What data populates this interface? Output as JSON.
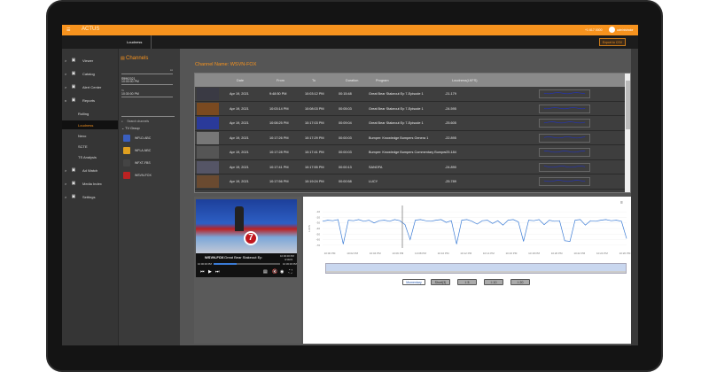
{
  "header": {
    "logo": "ACTUS",
    "phone": "+1 617 0000",
    "user": "administrator",
    "accent": "#f7931e"
  },
  "tabs": [
    {
      "label": "Loudness",
      "active": true
    }
  ],
  "export_label": "Export to CSV",
  "sidebar": {
    "items": [
      {
        "label": "Viewer",
        "icon": "monitor-icon",
        "chevron": ">"
      },
      {
        "label": "Catalog",
        "icon": "list-icon",
        "chevron": ">"
      },
      {
        "label": "Alert Center",
        "icon": "bell-icon",
        "chevron": ">"
      },
      {
        "label": "Reports",
        "icon": "trend-icon",
        "chevron": "v"
      },
      {
        "label": "Rolling",
        "sub": true
      },
      {
        "label": "Loudness",
        "sub": true,
        "active": true
      },
      {
        "label": "Nexo",
        "sub": true
      },
      {
        "label": "SCTE",
        "sub": true
      },
      {
        "label": "TS Analysis",
        "sub": true
      },
      {
        "label": "Ad Watch",
        "icon": "ad-icon",
        "chevron": ">"
      },
      {
        "label": "Media Index",
        "icon": "media-icon",
        "chevron": ">"
      },
      {
        "label": "Settings",
        "icon": "gear-icon",
        "chevron": ">"
      }
    ]
  },
  "channels": {
    "title": "Channels",
    "date": "4/19/2021",
    "from_label": "From",
    "from": "10:00:00 PM",
    "to_label": "To",
    "to": "10:30:00 PM",
    "search_placeholder": "Search channels",
    "group": "TV Group",
    "list": [
      "WFLD-ABC",
      "WFLA-NBC",
      "WFXT-FBS",
      "WSVN-FOX"
    ]
  },
  "main": {
    "channel_name": "Channel Name: WSVN-FOX",
    "columns": [
      "Date",
      "From",
      "To",
      "Duration",
      "Program",
      "Loudness(LKFS)"
    ],
    "rows": [
      [
        "Apr 19, 2021",
        "9:48:50 PM",
        "10:03:12 PM",
        "00:15:48",
        "Great Bear Stakeout Ep 7-Episode 1",
        "-21.179"
      ],
      [
        "Apr 19, 2021",
        "10:03:14 PM",
        "10:08:03 PM",
        "00:05:03",
        "Great Bear Stakeout Ep 7-Episode 1",
        "-24.595"
      ],
      [
        "Apr 19, 2021",
        "10:08:25 PM",
        "10:17:03 PM",
        "00:09:04",
        "Great Bear Stakeout Ep 7-Episode 1",
        "-25.605"
      ],
      [
        "Apr 19, 2021",
        "10:17:26 PM",
        "10:17:29 PM",
        "00:00:03",
        "Bumper: Knowledge Bumpers Genera 1",
        "-22.895"
      ],
      [
        "Apr 19, 2021",
        "10:17:28 PM",
        "10:17:41 PM",
        "00:00:03",
        "Bumper: Knowledge Bumpers Commentary Bumper",
        "-25.184"
      ],
      [
        "Apr 19, 2021",
        "10:17:41 PM",
        "10:17:55 PM",
        "00:00:13",
        "SANOFA",
        "-24.890"
      ],
      [
        "Apr 19, 2021",
        "10:17:56 PM",
        "10:19:24 PM",
        "00:00:58",
        "LUCY",
        "-25.789"
      ]
    ]
  },
  "player": {
    "channel": "WSVN-FOX",
    "program": "Great Bear Stakeout Ep",
    "time": "10:00:00 PM",
    "date": "4/19/21",
    "start": "10:00:00 PM",
    "end": "10:30:00 PM",
    "progress": 0.35
  },
  "chart_buttons": [
    {
      "label": "Momentary",
      "active": true
    },
    {
      "label": "Short(3)"
    },
    {
      "label": "I: 5"
    },
    {
      "label": "I: 10"
    },
    {
      "label": "I: 20"
    }
  ],
  "chart_data": {
    "type": "line",
    "ylabel": "LUFS",
    "ylim": [
      -75,
      -5
    ],
    "yticks": [
      -10,
      -20,
      -30,
      -40,
      -50,
      -60,
      -70
    ],
    "xticks": [
      "10:00 PM",
      "10:02 PM",
      "10:04 PM",
      "10:06 PM",
      "10:08 PM",
      "10:10 PM",
      "10:12 PM",
      "10:14 PM",
      "10:16 PM",
      "10:18 PM",
      "10:20 PM",
      "10:22 PM",
      "10:24 PM",
      "10:26 PM"
    ],
    "values": [
      -27,
      -25,
      -26,
      -24,
      -68,
      -25,
      -26,
      -24,
      -27,
      -25,
      -30,
      -26,
      -25,
      -27,
      -24,
      -26,
      -33,
      -60,
      -25,
      -24,
      -26,
      -27,
      -25,
      -24,
      -29,
      -26,
      -68,
      -25,
      -24,
      -27,
      -32,
      -26,
      -25,
      -31,
      -26,
      -34,
      -25,
      -24,
      -28,
      -63,
      -25,
      -26,
      -24,
      -33,
      -25,
      -27,
      -26,
      -62,
      -63,
      -25,
      -24,
      -34,
      -26,
      -27,
      -25,
      -24,
      -26,
      -25,
      -27,
      -58
    ],
    "series_color": "#3a7bd5"
  }
}
